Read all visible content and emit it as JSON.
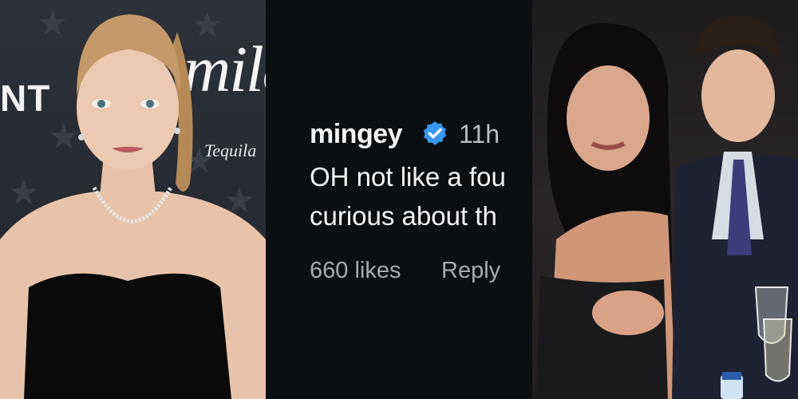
{
  "panels": {
    "left": {
      "backdrop": {
        "text_nt": "NT",
        "text_mila": "mila",
        "text_tequila": "Tequila"
      }
    },
    "middle": {
      "comment": {
        "username": "mingey",
        "verified": true,
        "timestamp": "11h",
        "text_line_1": "OH not like a fou",
        "text_line_2": "curious about th",
        "likes": "660 likes",
        "reply_label": "Reply"
      }
    },
    "right": {}
  },
  "colors": {
    "panel_mid_bg": "#0c0f12",
    "verified_badge": "#3897f0",
    "username": "#f3f5f7",
    "meta_text": "#a8acb2"
  },
  "icons": [
    "verified-badge-icon"
  ]
}
